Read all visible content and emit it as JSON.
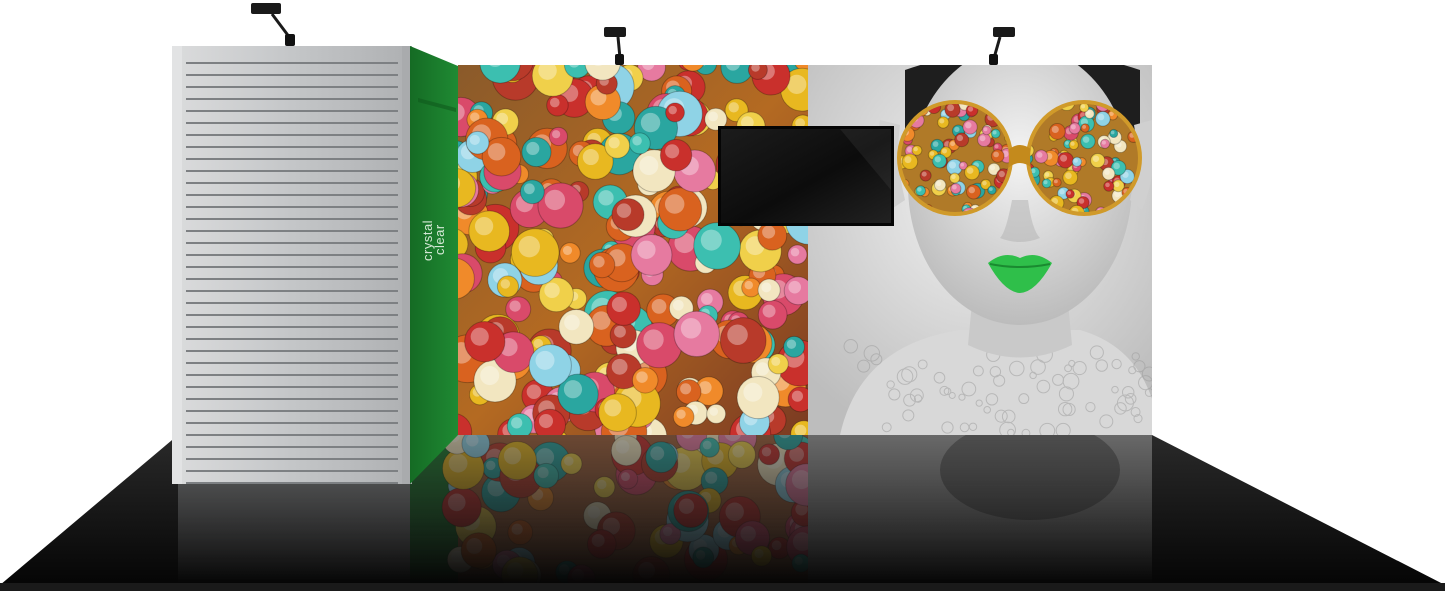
{
  "logo": {
    "line1": "crystal",
    "line2": "clear"
  },
  "colors": {
    "background": "#ffffff",
    "floor": "#0c0c0c",
    "brand_green": "#1b7a2c",
    "slatwall": "#bfc1c3",
    "portrait_bg": "#cfcfcf",
    "lips": "#2fbf4a",
    "glasses_frame": "#d09a2a",
    "monitor": "#121212"
  },
  "icons": {
    "spotlight": "spotlight-icon"
  }
}
